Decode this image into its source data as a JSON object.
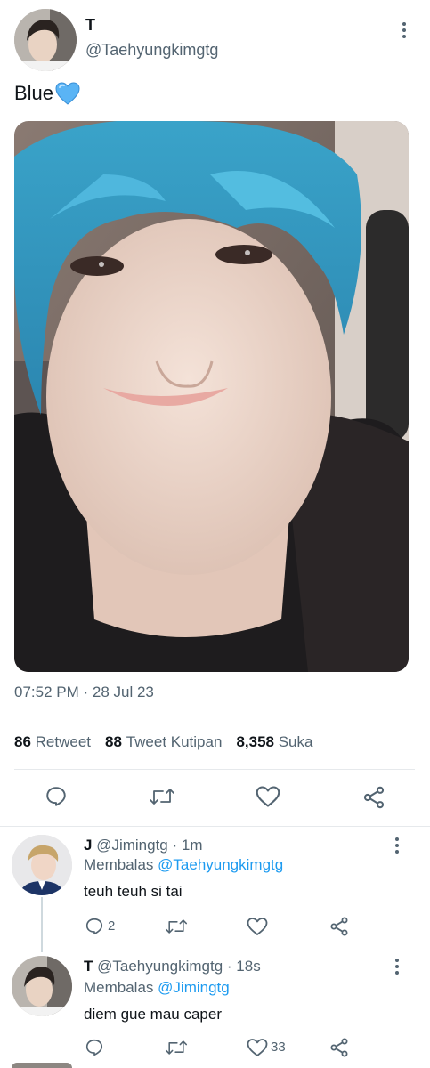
{
  "tweet": {
    "display_name": "T",
    "handle": "@Taehyungkimgtg",
    "text": "Blue",
    "timestamp": "07:52 PM · 28 Jul 23",
    "stats": {
      "retweets": "86",
      "retweets_label": "Retweet",
      "quotes": "88",
      "quotes_label": "Tweet Kutipan",
      "likes": "8,358",
      "likes_label": "Suka"
    }
  },
  "replies": [
    {
      "display_name": "J",
      "handle": "@Jimingtg",
      "time": "· 1m",
      "replying_label": "Membalas",
      "replying_to": "@Taehyungkimgtg",
      "text": "teuh teuh si tai",
      "reply_count": "2",
      "like_count": ""
    },
    {
      "display_name": "T",
      "handle": "@Taehyungkimgtg",
      "time": "· 18s",
      "replying_label": "Membalas",
      "replying_to": "@Jimingtg",
      "text": "diem gue mau caper",
      "reply_count": "",
      "like_count": "33"
    }
  ],
  "icons": [
    "reply-icon",
    "retweet-icon",
    "like-icon",
    "share-icon",
    "more-icon",
    "blue-heart-emoji"
  ],
  "colors": {
    "link": "#1d9bf0",
    "muted": "#536471",
    "text": "#0f1419",
    "divider": "#e6e9ec",
    "heart": "#5ab4f5"
  }
}
